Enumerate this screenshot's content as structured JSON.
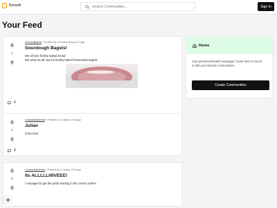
{
  "header": {
    "logo_text": "Breadit",
    "search": {
      "placeholder": "Search Communities..."
    },
    "signin_label": "Sign In"
  },
  "feed": {
    "title": "Your Feed",
    "posts": [
      {
        "subreddit": "r/FreshBaked",
        "meta": " • Posted by u/CentuuSoup 2m ago",
        "title": "Sourdough Bagels!",
        "body_lines": [
          "We all love freshly baked bread",
          "But what we all need is freshly baked homemade bagels"
        ],
        "has_image": true,
        "votes": "1",
        "comments": "0"
      },
      {
        "subreddit": "r/Julianisthebest",
        "meta": " • Posted by u/Julian 27d ago",
        "title": "Julian",
        "body_lines": [
          "is the best"
        ],
        "has_image": false,
        "votes": "1",
        "comments": "4"
      },
      {
        "subreddit": "r/Julianisthebest",
        "meta": " • Posted by u/Julian 27d ago",
        "title": "Its ALLLLLIIIIVEEE!",
        "body_lines": [
          "I managed to get the posts loading in the correct order!!"
        ],
        "has_image": false,
        "votes": "0",
        "comments": "0"
      }
    ]
  },
  "sidebar": {
    "title": "Home",
    "description": "Your personal Breadit homepage. Come here to check in with your favorite communities.",
    "button_label": "Create Communities"
  },
  "colors": {
    "accent_green": "#dcfce7",
    "brand_orange": "#f59e0b",
    "button_dark": "#111111"
  }
}
